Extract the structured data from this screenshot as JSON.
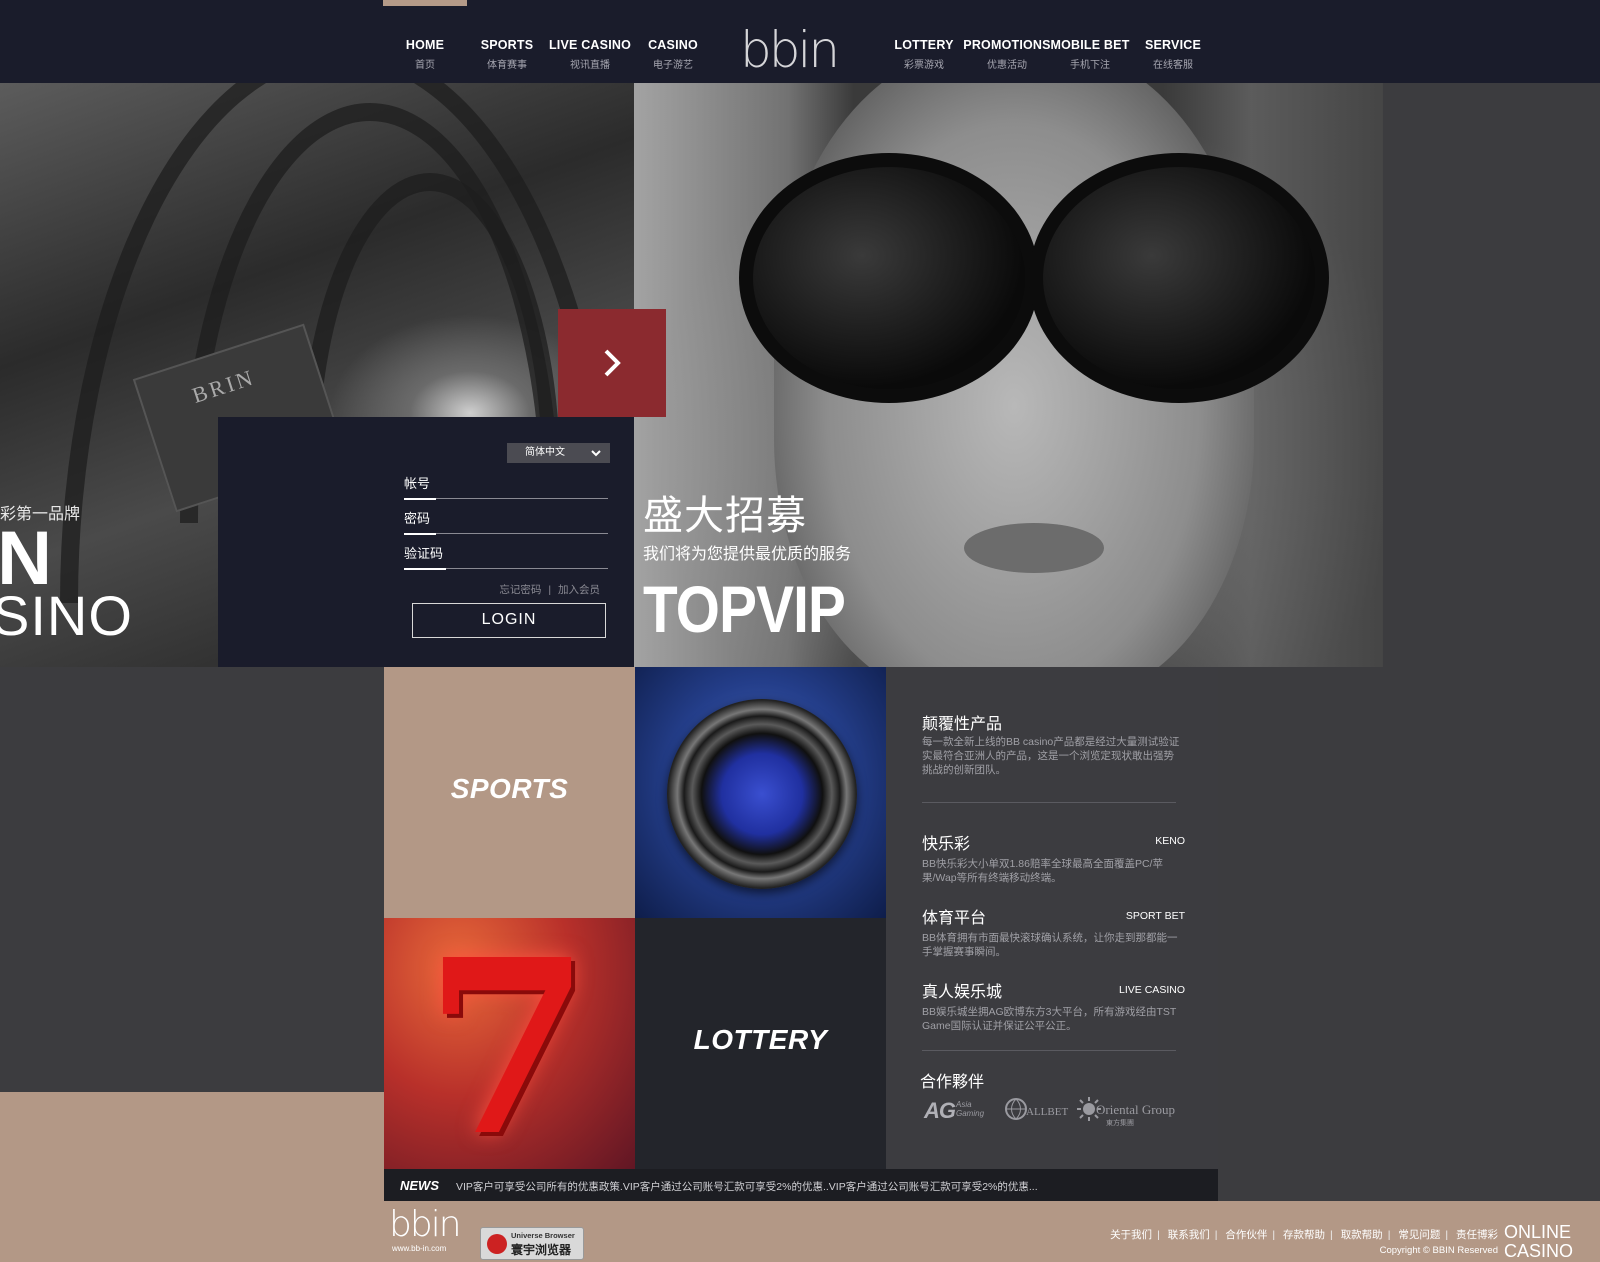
{
  "nav": {
    "left": [
      {
        "en": "HOME",
        "zh": "首页"
      },
      {
        "en": "SPORTS",
        "zh": "体育赛事"
      },
      {
        "en": "LIVE CASINO",
        "zh": "视讯直播"
      },
      {
        "en": "CASINO",
        "zh": "电子游艺"
      }
    ],
    "logo": "bbin",
    "right": [
      {
        "en": "LOTTERY",
        "zh": "彩票游戏"
      },
      {
        "en": "PROMOTIONS",
        "zh": "优惠活动"
      },
      {
        "en": "MOBILE BET",
        "zh": "手机下注"
      },
      {
        "en": "SERVICE",
        "zh": "在线客服"
      }
    ]
  },
  "hero": {
    "slogan_zh": "彩第一品牌",
    "slogan_big": "IN",
    "slogan_casino": "SINO",
    "book_text": "BRIN",
    "promo_zh1": "盛大招募",
    "promo_zh2": "我们将为您提供最优质的服务",
    "promo_en": "TOPVIP"
  },
  "login": {
    "language": "简体中文",
    "account_label": "帐号",
    "password_label": "密码",
    "captcha_label": "验证码",
    "forgot": "忘记密码",
    "link_sep": "|",
    "join": "加入会员",
    "button": "LOGIN"
  },
  "tiles": {
    "sports": "SPORTS",
    "lottery": "LOTTERY",
    "seven": "7"
  },
  "info": {
    "sections": [
      {
        "title": "颠覆性产品",
        "tag": "",
        "desc": "每一款全新上线的BB casino产品都是经过大量测试验证实最符合亚洲人的产品，这是一个浏览定现状敢出强势挑战的创新团队。"
      },
      {
        "title": "快乐彩",
        "tag": "KENO",
        "desc": "BB快乐彩大小单双1.86赔率全球最高全面覆盖PC/苹果/Wap等所有终端移动终端。"
      },
      {
        "title": "体育平台",
        "tag": "SPORT BET",
        "desc": "BB体育拥有市面最快滚球确认系统，让你走到那都能一手掌握赛事瞬间。"
      },
      {
        "title": "真人娱乐城",
        "tag": "LIVE CASINO",
        "desc": "BB娱乐城坐拥AG欧博东方3大平台，所有游戏经由TST Game国际认证并保证公平公正。"
      }
    ],
    "partners_title": "合作夥伴",
    "partners": [
      "AG",
      "Asia Gaming",
      "ALLBET",
      "Oriental Group",
      "東方集團"
    ]
  },
  "news": {
    "label": "NEWS",
    "text": "VIP客户可享受公司所有的优惠政策.VIP客户通过公司账号汇款可享受2%的优惠..VIP客户通过公司账号汇款可享受2%的优惠..."
  },
  "footer": {
    "logo": "bbin",
    "url": "www.bb-in.com",
    "browser_en": "Universe Browser",
    "browser_zh": "寰宇浏览器",
    "links": [
      "关于我们",
      "联系我们",
      "合作伙伴",
      "存款帮助",
      "取款帮助",
      "常见问题",
      "责任博彩"
    ],
    "copyright": "Copyright © BBIN Reserved",
    "online_line1": "ONLINE",
    "online_line2": "CASINO"
  },
  "colors": {
    "nav_bg": "#1a1c2b",
    "accent_tan": "#b39886",
    "arrow_red": "#8b2a2f",
    "panel_gray": "#3c3c40"
  }
}
